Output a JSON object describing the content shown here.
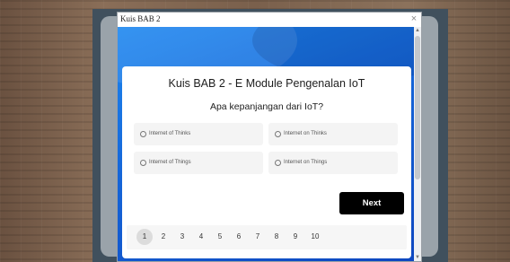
{
  "window": {
    "title": "Kuis BAB 2",
    "close_glyph": "×"
  },
  "quiz": {
    "title": "Kuis BAB 2 - E Module Pengenalan IoT",
    "question": "Apa kepanjangan dari IoT?",
    "options": [
      "Internet of Thinks",
      "Internet on Thinks",
      "Internet of Things",
      "Internet on Things"
    ],
    "next_label": "Next"
  },
  "pagination": {
    "pages": [
      "1",
      "2",
      "3",
      "4",
      "5",
      "6",
      "7",
      "8",
      "9",
      "10"
    ],
    "current": "1"
  },
  "colors": {
    "header_blue": "#1565d8",
    "button": "#000000",
    "backdrop": "#40505d"
  },
  "icons": {
    "close": "close-icon",
    "scroll_up": "arrow-up-icon",
    "scroll_down": "arrow-down-icon",
    "radio": "radio-empty-icon"
  }
}
